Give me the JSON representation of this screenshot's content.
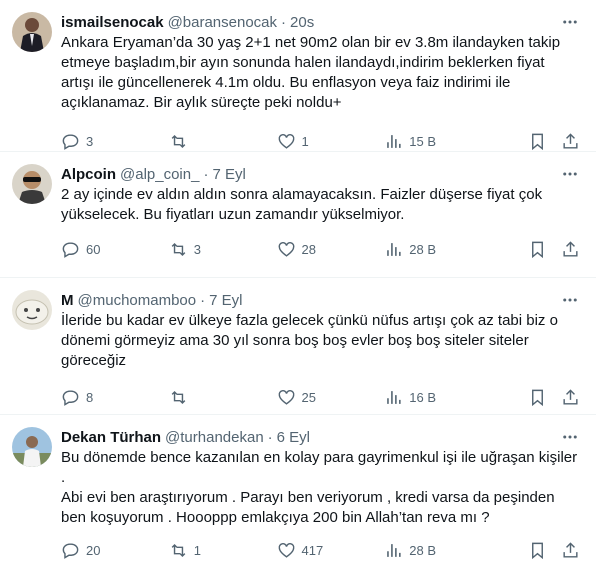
{
  "tweets": [
    {
      "name": "ismailsenocak",
      "handle": "@baransenocak",
      "time": "20s",
      "text": "Ankara Eryaman’da 30 yaş 2+1 net 90m2 olan bir ev 3.8m ilandayken takip etmeye başladım,bir ayın sonunda halen ilandaydı,indirim beklerken fiyat artışı ile güncellenerek 4.1m oldu. Bu enflasyon veya faiz indirimi ile açıklanamaz. Bir aylık süreçte peki noldu+",
      "replies": "3",
      "retweets": "",
      "likes": "1",
      "views": "15 B"
    },
    {
      "name": "Alpcoin",
      "handle": "@alp_coin_",
      "time": "7 Eyl",
      "text": "2 ay içinde ev aldın aldın sonra alamayacaksın. Faizler düşerse fiyat çok yükselecek. Bu fiyatları uzun zamandır yükselmiyor.",
      "replies": "60",
      "retweets": "3",
      "likes": "28",
      "views": "28 B"
    },
    {
      "name": "M",
      "handle": "@muchomamboo",
      "time": "7 Eyl",
      "text": "İleride bu kadar ev ülkeye fazla gelecek çünkü nüfus artışı çok az tabi biz o dönemi görmeyiz ama 30 yıl sonra boş boş evler boş boş siteler siteler göreceğiz",
      "replies": "8",
      "retweets": "",
      "likes": "25",
      "views": "16 B"
    },
    {
      "name": "Dekan Türhan",
      "handle": "@turhandekan",
      "time": "6 Eyl",
      "text": "Bu dönemde bence kazanılan en kolay para gayrimenkul işi ile uğraşan kişiler .\nAbi evi ben araştırıyorum . Parayı ben veriyorum , kredi varsa da peşinden ben koşuyorum . Hoooppp emlakçıya 200 bin Allah’tan reva mı ?",
      "replies": "20",
      "retweets": "1",
      "likes": "417",
      "views": "28 B"
    }
  ],
  "colors": {
    "text": "#0f1419",
    "muted": "#536471",
    "divider": "#eff3f4"
  },
  "icons": [
    "more-icon",
    "reply-icon",
    "retweet-icon",
    "like-icon",
    "views-icon",
    "bookmark-icon",
    "share-icon"
  ]
}
